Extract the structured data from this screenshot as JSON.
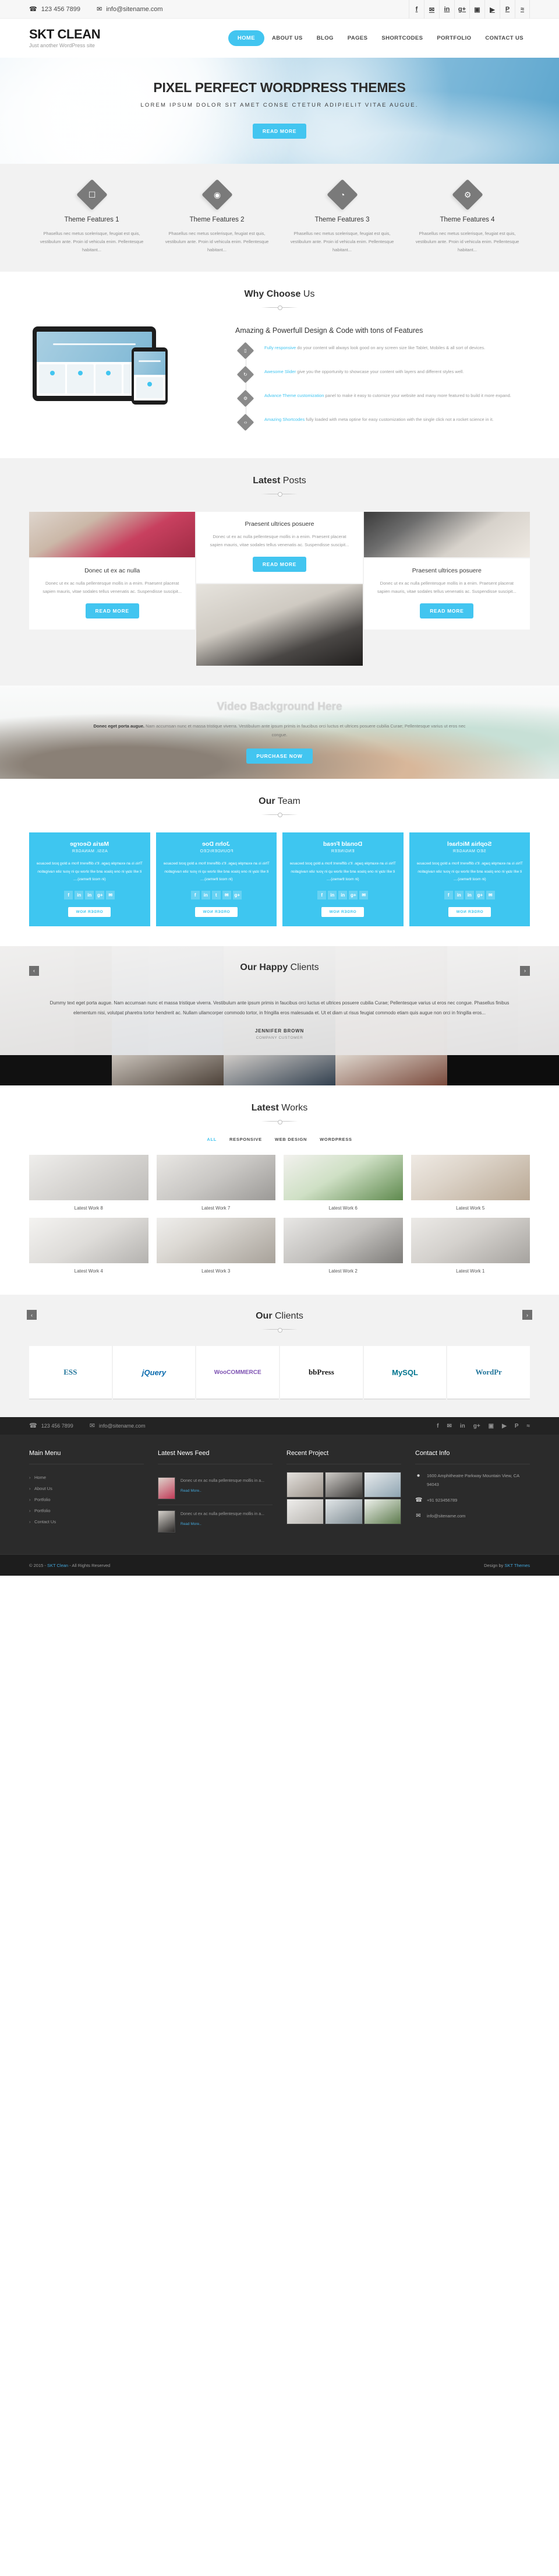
{
  "topbar": {
    "phone": "123 456 7899",
    "email": "info@sitename.com",
    "phone_icon": "phone-icon",
    "email_icon": "envelope-icon",
    "socials": [
      "f",
      "✉",
      "in",
      "g+",
      "▣",
      "▶",
      "P",
      "≈"
    ],
    "social_names": [
      "facebook",
      "twitter",
      "linkedin",
      "googleplus",
      "instagram",
      "youtube",
      "pinterest",
      "rss"
    ]
  },
  "header": {
    "logo": "SKT CLEAN",
    "tagline": "Just another WordPress site",
    "nav": [
      {
        "label": "HOME",
        "active": true
      },
      {
        "label": "ABOUT US",
        "active": false
      },
      {
        "label": "BLOG",
        "active": false
      },
      {
        "label": "PAGES",
        "active": false
      },
      {
        "label": "SHORTCODES",
        "active": false
      },
      {
        "label": "PORTFOLIO",
        "active": false
      },
      {
        "label": "CONTACT US",
        "active": false
      }
    ]
  },
  "hero": {
    "title": "PIXEL PERFECT WORDPRESS THEMES",
    "subtitle": "LOREM IPSUM DOLOR SIT AMET CONSE CTETUR ADIPIELIT VITAE AUGUE.",
    "button": "READ MORE"
  },
  "features": [
    {
      "title": "Theme Features 1",
      "icon": "monitor-icon",
      "glyph": "☐",
      "text": "Phasellus nec metus scelerisque, feugiat est quis, vestibulum ante. Proin id vehicula enim. Pellentesque habitant..."
    },
    {
      "title": "Theme Features 2",
      "icon": "eye-icon",
      "glyph": "◉",
      "text": "Phasellus nec metus scelerisque, feugiat est quis, vestibulum ante. Proin id vehicula enim. Pellentesque habitant..."
    },
    {
      "title": "Theme Features 3",
      "icon": "clock-icon",
      "glyph": "◔",
      "text": "Phasellus nec metus scelerisque, feugiat est quis, vestibulum ante. Proin id vehicula enim. Pellentesque habitant..."
    },
    {
      "title": "Theme Features 4",
      "icon": "gear-icon",
      "glyph": "⚙",
      "text": "Phasellus nec metus scelerisque, feugiat est quis, vestibulum ante. Proin id vehicula enim. Pellentesque habitant..."
    }
  ],
  "why": {
    "heading_bold": "Why Choose",
    "heading_light": " Us",
    "subheading": "Amazing & Powerfull Design & Code with tons of Features",
    "items": [
      {
        "icon": "mobile-icon",
        "glyph": "▯",
        "link": "Fully responsive",
        "text": " do your content will always look good on any screen size like Tablet, Mobiles & all sort of devices."
      },
      {
        "icon": "refresh-icon",
        "glyph": "↻",
        "link": "Awesome Slider",
        "text": " give you the opportunity to showcase your content with layers and different styles well."
      },
      {
        "icon": "gears-icon",
        "glyph": "⚙",
        "link": "Advance Theme customization",
        "text": " panel to make it easy to cutomize your website and many more featured to build it more expand."
      },
      {
        "icon": "code-icon",
        "glyph": "‹›",
        "link": "Amazing Shortcodes",
        "text": " fully loaded with meta optine for easy customization with the single click not a rocket science in it."
      }
    ]
  },
  "posts": {
    "heading_bold": "Latest",
    "heading_light": " Posts",
    "button": "READ MORE",
    "items": [
      {
        "title": "Donec ut ex ac nulla",
        "text": "Donec ut ex ac nulla pellentesque mollis in a enim. Praesent placerat sapien mauris, vitae sodales tellus venenatis ac. Suspendisse suscipit..."
      },
      {
        "title": "Praesent ultrices posuere",
        "text": "Donec ut ex ac nulla pellentesque mollis in a enim. Praesent placerat sapien mauris, vitae sodales tellus venenatis ac. Suspendisse suscipit..."
      },
      {
        "title": "Praesent ultrices posuere",
        "text": "Donec ut ex ac nulla pellentesque mollis in a enim. Praesent placerat sapien mauris, vitae sodales tellus venenatis ac. Suspendisse suscipit..."
      }
    ]
  },
  "video": {
    "title": "Video Background Here",
    "lead": "Donec eget porta augue.",
    "text": " Nam accumsan nunc et massa tristique viverra. Vestibulum ante ipsum primis in faucibus orci luctus et ultrices posuere cubilia Curae; Pellentesque varius ut eros nec congue.",
    "button": "PURCHASE NOW"
  },
  "team": {
    "heading_bold": "Our",
    "heading_light": " Team",
    "button": "ORDER NOW",
    "members": [
      {
        "name": "Maria George",
        "role": "ASSI. MANAGER",
        "text": "This is an example page. It's different from a blog post because it will stay in one place and will show up in your site navigation (in most themes)....",
        "socials": [
          "f",
          "in",
          "in",
          "g+",
          "✉"
        ]
      },
      {
        "name": "John Doe",
        "role": "FOUNDER/CEO",
        "text": "This is an example page. It's different from a blog post because it will stay in one place and will show up in your site navigation (in most themes)....",
        "socials": [
          "f",
          "in",
          "t",
          "✉",
          "g+"
        ]
      },
      {
        "name": "Donald Fread",
        "role": "ENGINEER",
        "text": "This is an example page. It's different from a blog post because it will stay in one place and will show up in your site navigation (in most themes)....",
        "socials": [
          "f",
          "in",
          "in",
          "g+",
          "✉"
        ]
      },
      {
        "name": "Sophia Michael",
        "role": "SEO MANAGER",
        "text": "This is an example page. It's different from a blog post because it will stay in one place and will show up in your site navigation (in most themes)....",
        "socials": [
          "f",
          "in",
          "in",
          "g+",
          "✉"
        ]
      }
    ]
  },
  "testimonial": {
    "heading_bold": "Our Happy",
    "heading_light": " Clients",
    "quote": "Dummy text eget porta augue. Nam accumsan nunc et massa tristique viverra. Vestibulum ante ipsum primis in faucibus orci luctus et ultrices posuere cubilia Curae; Pellentesque varius ut eros nec congue. Phasellus finibus elementum nisi, volutpat pharetra tortor hendrerit ac. Nullam ullamcorper commodo tortor, in fringilla eros malesuada et. Ut et diam ut risus feugiat commodo etiam quis augue non orci in fringilla eros...",
    "author": "JENNIFER BROWN",
    "author_role": "COMPANY CUSTOMER",
    "prev": "‹",
    "next": "›"
  },
  "works": {
    "heading_bold": "Latest",
    "heading_light": " Works",
    "filters": [
      {
        "label": "ALL",
        "active": true
      },
      {
        "label": "RESPONSIVE",
        "active": false
      },
      {
        "label": "WEB DESIGN",
        "active": false
      },
      {
        "label": "WORDPRESS",
        "active": false
      }
    ],
    "items": [
      {
        "caption": "Latest Work 8"
      },
      {
        "caption": "Latest Work 7"
      },
      {
        "caption": "Latest Work 6"
      },
      {
        "caption": "Latest Work 5"
      },
      {
        "caption": "Latest Work 4"
      },
      {
        "caption": "Latest Work 3"
      },
      {
        "caption": "Latest Work 2"
      },
      {
        "caption": "Latest Work 1"
      }
    ]
  },
  "clients": {
    "heading_bold": "Our",
    "heading_light": " Clients",
    "prev": "‹",
    "next": "›",
    "logos": [
      {
        "name": "wordpress-partial",
        "text": "ESS",
        "color": "#21759b"
      },
      {
        "name": "jquery",
        "text": "jQuery",
        "color": "#0769ad"
      },
      {
        "name": "woocommerce",
        "text": "WooCOMMERCE",
        "color": "#7f54b3"
      },
      {
        "name": "bbpress",
        "text": "bbPress",
        "color": "#1a1a1a"
      },
      {
        "name": "mysql",
        "text": "MySQL",
        "color": "#00758f"
      },
      {
        "name": "wordpress",
        "text": "WordPr",
        "color": "#21759b"
      }
    ]
  },
  "footer": {
    "phone": "123 456 7899",
    "email": "info@sitename.com",
    "socials": [
      "f",
      "✉",
      "in",
      "g+",
      "▣",
      "▶",
      "P",
      "≈"
    ],
    "main_menu": {
      "title": "Main Menu",
      "items": [
        "Home",
        "About Us",
        "Portfolio",
        "Portfolio",
        "Contact Us"
      ]
    },
    "news": {
      "title": "Latest News Feed",
      "items": [
        {
          "text": "Donec ut ex ac nulla pellentesque mollis in a...",
          "link": "Read More.."
        },
        {
          "text": "Donec ut ex ac nulla pellentesque mollis in a...",
          "link": "Read More.."
        }
      ]
    },
    "project": {
      "title": "Recent Project"
    },
    "contact": {
      "title": "Contact Info",
      "address": "1600 Amphitheatre Parkway Mountain View, CA 94043",
      "phone": "+91 923456789",
      "email": "info@sitename.com",
      "address_icon": "map-pin-icon",
      "phone_icon": "phone-icon",
      "email_icon": "envelope-icon"
    },
    "copyright_pre": "© 2015 - ",
    "copyright_link": "SKT Clean",
    "copyright_post": " - All Rights Reserved",
    "design_pre": "Design by ",
    "design_link": "SKT Themes"
  }
}
